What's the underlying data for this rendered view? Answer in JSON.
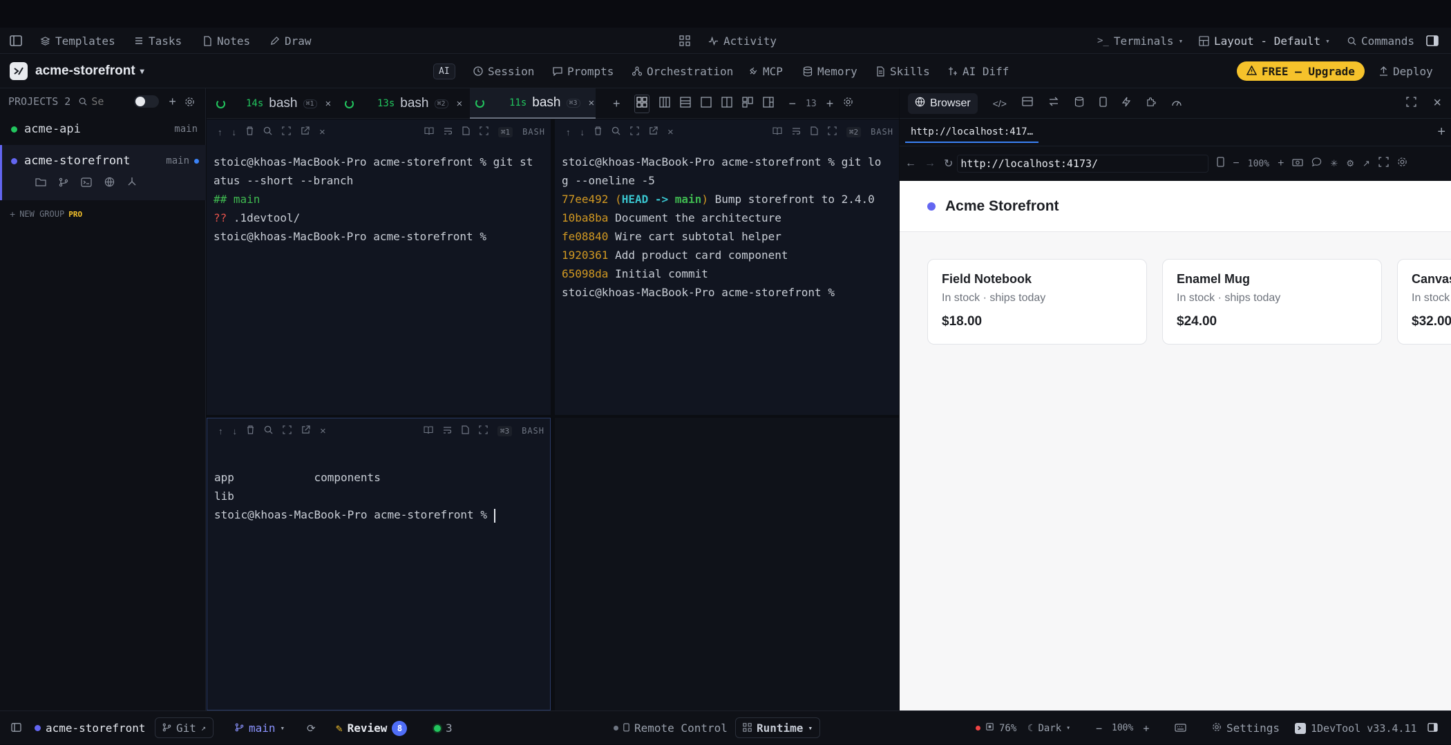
{
  "menubar": {
    "templates": "Templates",
    "tasks": "Tasks",
    "notes": "Notes",
    "draw": "Draw",
    "activity": "Activity",
    "terminals": "Terminals",
    "layout": "Layout - Default",
    "commands": "Commands"
  },
  "appbar": {
    "project": "acme-storefront",
    "ai_badge": "AI",
    "session": "Session",
    "prompts": "Prompts",
    "orchestration": "Orchestration",
    "mcp": "MCP",
    "memory": "Memory",
    "skills": "Skills",
    "ai_diff": "AI Diff",
    "upgrade": "FREE — Upgrade",
    "deploy": "Deploy"
  },
  "sidebar": {
    "projects_label": "PROJECTS 2",
    "search_placeholder": "Se",
    "projects": [
      {
        "name": "acme-api",
        "branch": "main",
        "color": "#22c55e"
      },
      {
        "name": "acme-storefront",
        "branch": "main",
        "color": "#6366f1"
      }
    ],
    "new_group": "NEW GROUP",
    "pro": "PRO"
  },
  "terminal_tabs": [
    {
      "time": "14s",
      "name": "bash",
      "key": "⌘1"
    },
    {
      "time": "13s",
      "name": "bash",
      "key": "⌘2"
    },
    {
      "time": "11s",
      "name": "bash",
      "key": "⌘3"
    }
  ],
  "terminal_toolbar": {
    "font_size": "13"
  },
  "panes": [
    {
      "key": "⌘1",
      "shell": "BASH",
      "lines": [
        "stoic@khoas-MacBook-Pro acme-storefront % git st",
        "atus --short --branch",
        "## main",
        "?? .1devtool/",
        "stoic@khoas-MacBook-Pro acme-storefront %"
      ]
    },
    {
      "key": "⌘2",
      "shell": "BASH",
      "lines": [
        "stoic@khoas-MacBook-Pro acme-storefront % git lo",
        "g --oneline -5"
      ],
      "commits": [
        {
          "hash": "77ee492",
          "ref_open": "(",
          "head": "HEAD -> ",
          "branch": "main",
          "ref_close": ")",
          "msg": " Bump storefront to 2.4.0"
        },
        {
          "hash": "10ba8ba",
          "msg": " Document the architecture"
        },
        {
          "hash": "fe08840",
          "msg": " Wire cart subtotal helper"
        },
        {
          "hash": "1920361",
          "msg": " Add product card component"
        },
        {
          "hash": "65098da",
          "msg": " Initial commit"
        }
      ],
      "prompt": "stoic@khoas-MacBook-Pro acme-storefront %"
    },
    {
      "key": "⌘3",
      "shell": "BASH",
      "lines": [
        "app            components",
        "lib",
        "stoic@khoas-MacBook-Pro acme-storefront % "
      ]
    }
  ],
  "browser": {
    "tab_label": "Browser",
    "page_tab": "http://localhost:417…",
    "url": "http://localhost:4173/",
    "zoom": "100%",
    "site_title": "Acme Storefront",
    "products": [
      {
        "name": "Field Notebook",
        "stock": "In stock · ships today",
        "price": "$18.00"
      },
      {
        "name": "Enamel Mug",
        "stock": "In stock · ships today",
        "price": "$24.00"
      },
      {
        "name": "Canvas",
        "stock": "In stock",
        "price": "$32.00"
      }
    ]
  },
  "statusbar": {
    "project": "acme-storefront",
    "git": "Git",
    "branch": "main",
    "review": "Review",
    "review_count": "8",
    "running": "3",
    "remote": "Remote Control",
    "runtime": "Runtime",
    "cpu": "76%",
    "theme": "Dark",
    "zoom": "100%",
    "settings": "Settings",
    "version": "1DevTool v33.4.11"
  }
}
